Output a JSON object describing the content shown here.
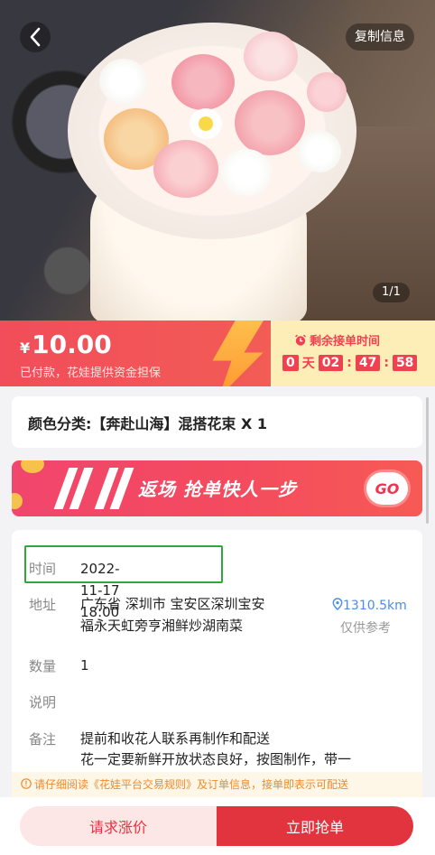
{
  "header": {
    "back_icon": "chevron-left-icon",
    "copy_label": "复制信息",
    "pager": "1/1"
  },
  "price": {
    "currency": "¥",
    "amount": "10.00",
    "guarantee": "已付款，花娃提供资金担保"
  },
  "timer": {
    "label": "剩余接单时间",
    "days": "0",
    "day_unit": "天",
    "hours": "02",
    "minutes": "47",
    "seconds": "58",
    "sep": ":"
  },
  "color_category": "颜色分类:【奔赴山海】混搭花束 X 1",
  "banner": {
    "text": "返场  抢单快人一步",
    "go": "GO"
  },
  "details": {
    "time_label": "时间",
    "time_value": "2022-11-17 18:00",
    "address_label": "地址",
    "address_line1": "广东省 深圳市 宝安区深圳宝安",
    "address_line2": "福永天虹旁亨湘鲜炒湖南菜",
    "distance": "1310.5km",
    "distance_note": "仅供参考",
    "qty_label": "数量",
    "qty_value": "1",
    "desc_label": "说明",
    "desc_value": "",
    "remark_label": "备注",
    "remark_line1": "提前和收花人联系再制作和配送",
    "remark_line2": "花一定要新鲜开放状态良好，按图制作，带一"
  },
  "notice": {
    "prefix": "请仔细阅读",
    "link": "《花娃平台交易规则》",
    "suffix": "及订单信息，接单即表示可配送"
  },
  "actions": {
    "raise": "请求涨价",
    "grab": "立即抢单"
  },
  "colors": {
    "accent": "#e2343f",
    "highlight_border": "#2da83b",
    "link_blue": "#4a8cf0",
    "notice_orange": "#f08a2a"
  }
}
